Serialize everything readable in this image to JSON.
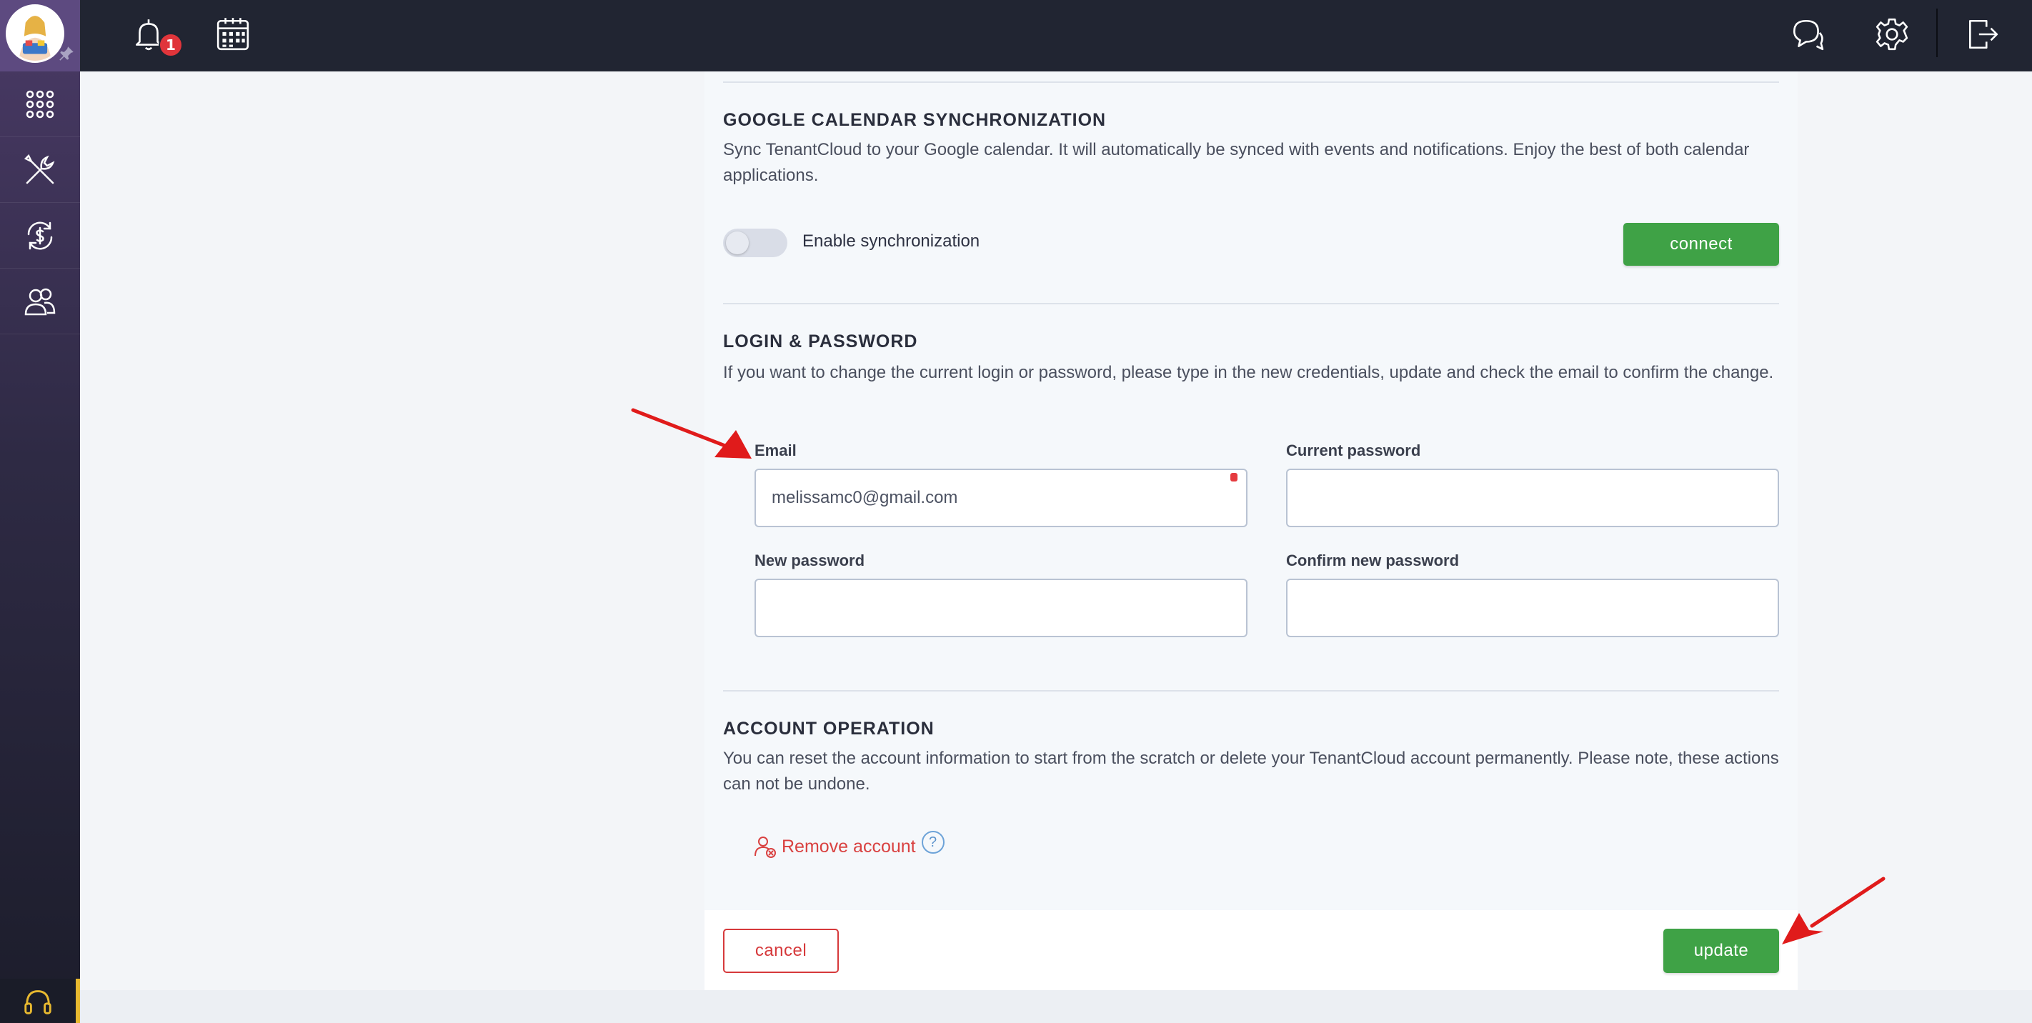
{
  "topbar": {
    "notification_count": "1"
  },
  "google_calendar": {
    "title": "GOOGLE CALENDAR SYNCHRONIZATION",
    "description": "Sync TenantCloud to your Google calendar. It will automatically be synced with events and notifications. Enjoy the best of both calendar applications.",
    "toggle_label": "Enable synchronization",
    "toggle_on": false,
    "connect_label": "connect"
  },
  "login": {
    "title": "LOGIN & PASSWORD",
    "description": "If you want to change the current login or password, please type in the new credentials, update and check the email to confirm the change.",
    "email_label": "Email",
    "email_value": "melissamc0@gmail.com",
    "current_password_label": "Current password",
    "new_password_label": "New password",
    "confirm_password_label": "Confirm new password"
  },
  "account": {
    "title": "ACCOUNT OPERATION",
    "description": "You can reset the account information to start from the scratch or delete your TenantCloud account permanently. Please note, these actions can not be undone.",
    "remove_label": "Remove account",
    "help_glyph": "?"
  },
  "footer": {
    "cancel_label": "cancel",
    "update_label": "update"
  },
  "colors": {
    "sidebar": "#2e2a44",
    "topbar": "#212532",
    "accent_green": "#3fa246",
    "danger_red": "#d6393b",
    "annotation_arrow": "#e01b1b"
  },
  "icons": [
    "avatar",
    "pin-icon",
    "apps-grid-icon",
    "tools-icon",
    "payments-icon",
    "users-icon",
    "headset-icon",
    "bell-icon",
    "calendar-icon",
    "chat-icon",
    "gear-icon",
    "logout-icon",
    "remove-user-icon",
    "help-icon"
  ]
}
